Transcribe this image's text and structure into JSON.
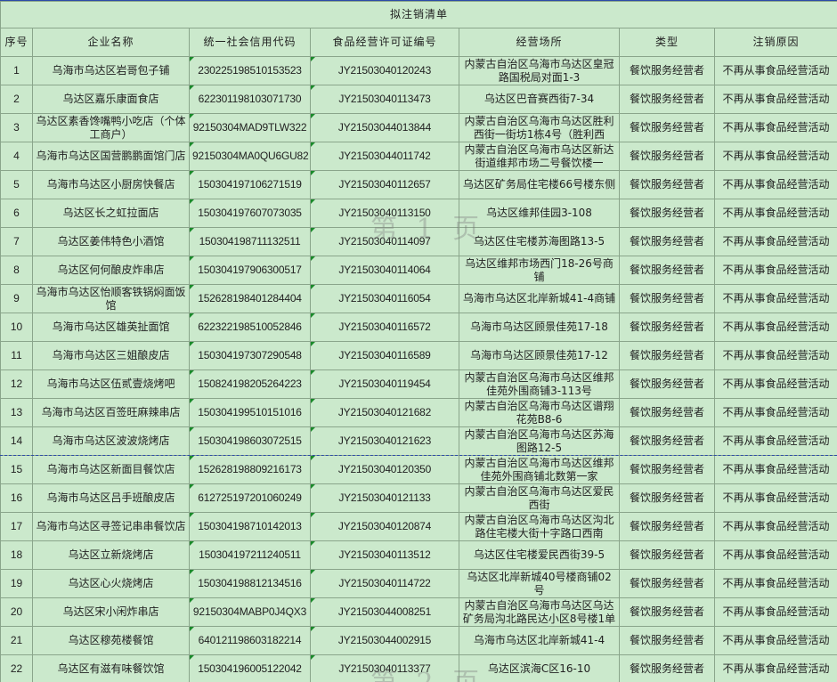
{
  "title": "拟注销清单",
  "headers": [
    "序号",
    "企业名称",
    "统一社会信用代码",
    "食品经营许可证编号",
    "经营场所",
    "类型",
    "注销原因"
  ],
  "rows": [
    {
      "no": "1",
      "name": "乌海市乌达区岩哥包子铺",
      "credit": "230225198510153523",
      "license": "JY21503040120243",
      "addr": "内蒙古自治区乌海市乌达区皇冠路国税局对面1-3",
      "type": "餐饮服务经营者",
      "reason": "不再从事食品经营活动"
    },
    {
      "no": "2",
      "name": "乌达区嘉乐康面食店",
      "credit": "622301198103071730",
      "license": "JY21503040113473",
      "addr": "乌达区巴音赛西街7-34",
      "type": "餐饮服务经营者",
      "reason": "不再从事食品经营活动"
    },
    {
      "no": "3",
      "name": "乌达区素香馋嘴鸭小吃店（个体工商户）",
      "credit": "92150304MAD9TLW322",
      "license": "JY21503044013844",
      "addr": "内蒙古自治区乌海市乌达区胜利西街一街坊1栋4号（胜利西",
      "type": "餐饮服务经营者",
      "reason": "不再从事食品经营活动"
    },
    {
      "no": "4",
      "name": "乌海市乌达区国营鹏鹏面馆门店",
      "credit": "92150304MA0QU6GU82",
      "license": "JY21503044011742",
      "addr": "内蒙古自治区乌海市乌达区新达街道维邦市场二号餐饮楼一",
      "type": "餐饮服务经营者",
      "reason": "不再从事食品经营活动"
    },
    {
      "no": "5",
      "name": "乌海市乌达区小厨房快餐店",
      "credit": "150304197106271519",
      "license": "JY21503040112657",
      "addr": "乌达区矿务局住宅楼66号楼东侧",
      "type": "餐饮服务经营者",
      "reason": "不再从事食品经营活动"
    },
    {
      "no": "6",
      "name": "乌达区长之虹拉面店",
      "credit": "150304197607073035",
      "license": "JY21503040113150",
      "addr": "乌达区维邦佳园3-108",
      "type": "餐饮服务经营者",
      "reason": "不再从事食品经营活动"
    },
    {
      "no": "7",
      "name": "乌达区姜伟特色小酒馆",
      "credit": "150304198711132511",
      "license": "JY21503040114097",
      "addr": "乌达区住宅楼苏海图路13-5",
      "type": "餐饮服务经营者",
      "reason": "不再从事食品经营活动"
    },
    {
      "no": "8",
      "name": "乌达区何何酿皮炸串店",
      "credit": "150304197906300517",
      "license": "JY21503040114064",
      "addr": "乌达区维邦市场西门18-26号商铺",
      "type": "餐饮服务经营者",
      "reason": "不再从事食品经营活动"
    },
    {
      "no": "9",
      "name": "乌海市乌达区怡顺客铁锅焖面饭馆",
      "credit": "152628198401284404",
      "license": "JY21503040116054",
      "addr": "乌海市乌达区北岸新城41-4商铺",
      "type": "餐饮服务经营者",
      "reason": "不再从事食品经营活动"
    },
    {
      "no": "10",
      "name": "乌海市乌达区雄英扯面馆",
      "credit": "622322198510052846",
      "license": "JY21503040116572",
      "addr": "乌海市乌达区顾景佳苑17-18",
      "type": "餐饮服务经营者",
      "reason": "不再从事食品经营活动"
    },
    {
      "no": "11",
      "name": "乌海市乌达区三姐酿皮店",
      "credit": "150304197307290548",
      "license": "JY21503040116589",
      "addr": "乌海市乌达区顾景佳苑17-12",
      "type": "餐饮服务经营者",
      "reason": "不再从事食品经营活动"
    },
    {
      "no": "12",
      "name": "乌海市乌达区伍贰壹烧烤吧",
      "credit": "150824198205264223",
      "license": "JY21503040119454",
      "addr": "内蒙古自治区乌海市乌达区维邦佳苑外围商铺3-113号",
      "type": "餐饮服务经营者",
      "reason": "不再从事食品经营活动"
    },
    {
      "no": "13",
      "name": "乌海市乌达区百签旺麻辣串店",
      "credit": "150304199510151016",
      "license": "JY21503040121682",
      "addr": "内蒙古自治区乌海市乌达区谱翔花苑B8-6",
      "type": "餐饮服务经营者",
      "reason": "不再从事食品经营活动"
    },
    {
      "no": "14",
      "name": "乌海市乌达区波波烧烤店",
      "credit": "150304198603072515",
      "license": "JY21503040121623",
      "addr": "内蒙古自治区乌海市乌达区苏海图路12-5",
      "type": "餐饮服务经营者",
      "reason": "不再从事食品经营活动"
    },
    {
      "no": "15",
      "name": "乌海市乌达区新面目餐饮店",
      "credit": "152628198809216173",
      "license": "JY21503040120350",
      "addr": "内蒙古自治区乌海市乌达区维邦佳苑外围商铺北数第一家",
      "type": "餐饮服务经营者",
      "reason": "不再从事食品经营活动"
    },
    {
      "no": "16",
      "name": "乌海市乌达区吕手班酿皮店",
      "credit": "612725197201060249",
      "license": "JY21503040121133",
      "addr": "内蒙古自治区乌海市乌达区爱民西街",
      "type": "餐饮服务经营者",
      "reason": "不再从事食品经营活动"
    },
    {
      "no": "17",
      "name": "乌海市乌达区寻签记串串餐饮店",
      "credit": "150304198710142013",
      "license": "JY21503040120874",
      "addr": "内蒙古自治区乌海市乌达区沟北路住宅楼大街十字路口西南",
      "type": "餐饮服务经营者",
      "reason": "不再从事食品经营活动"
    },
    {
      "no": "18",
      "name": "乌达区立新烧烤店",
      "credit": "150304197211240511",
      "license": "JY21503040113512",
      "addr": "乌达区住宅楼爱民西街39-5",
      "type": "餐饮服务经营者",
      "reason": "不再从事食品经营活动"
    },
    {
      "no": "19",
      "name": "乌达区心火烧烤店",
      "credit": "150304198812134516",
      "license": "JY21503040114722",
      "addr": "乌达区北岸新城40号楼商铺02号",
      "type": "餐饮服务经营者",
      "reason": "不再从事食品经营活动"
    },
    {
      "no": "20",
      "name": "乌达区宋小闲炸串店",
      "credit": "92150304MABP0J4QX3",
      "license": "JY21503044008251",
      "addr": "内蒙古自治区乌海市乌达区乌达矿务局沟北路民达小区8号楼1单元",
      "type": "餐饮服务经营者",
      "reason": "不再从事食品经营活动"
    },
    {
      "no": "21",
      "name": "乌达区穆苑楼餐馆",
      "credit": "640121198603182214",
      "license": "JY21503044002915",
      "addr": "乌海市乌达区北岸新城41-4",
      "type": "餐饮服务经营者",
      "reason": "不再从事食品经营活动"
    },
    {
      "no": "22",
      "name": "乌达区有滋有味餐饮馆",
      "credit": "150304196005122042",
      "license": "JY21503040113377",
      "addr": "乌达区滨海C区16-10",
      "type": "餐饮服务经营者",
      "reason": "不再从事食品经营活动"
    }
  ],
  "watermarks": [
    "第 1 页",
    "第 2 页"
  ]
}
